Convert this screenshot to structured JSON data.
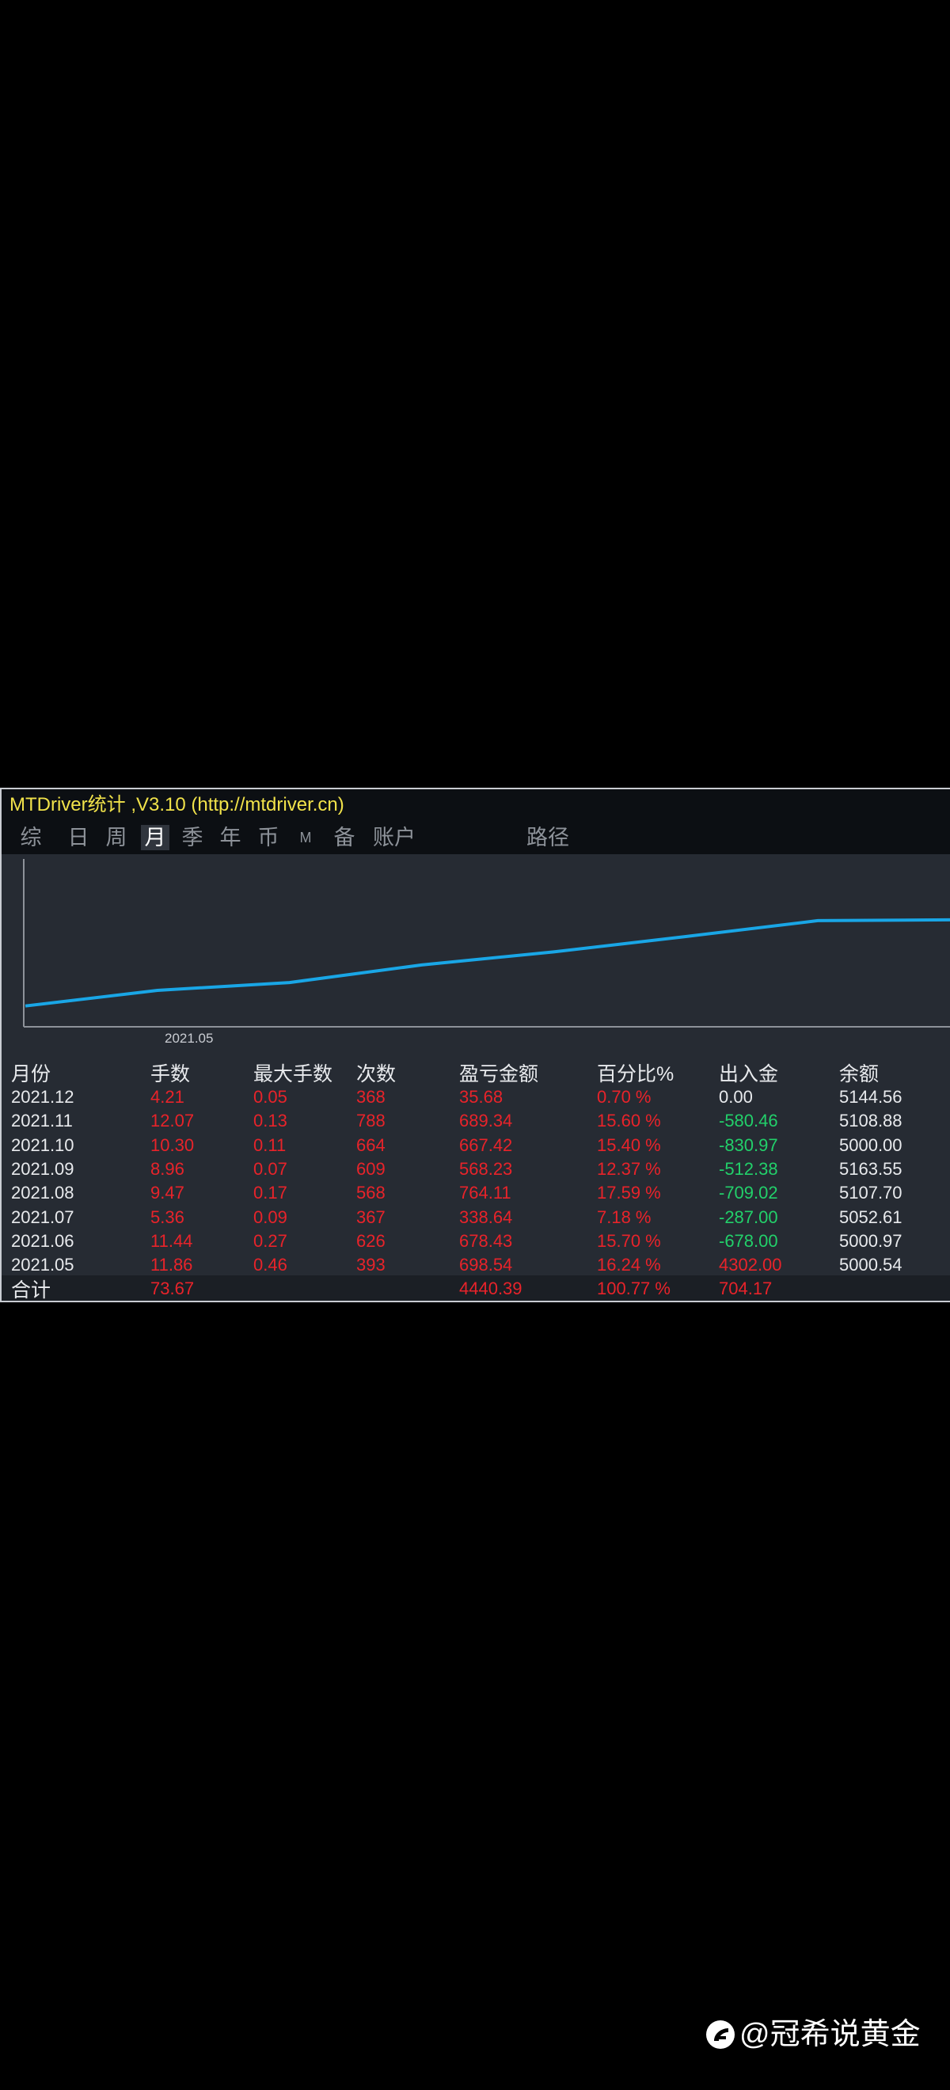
{
  "window": {
    "title": "MTDriver统计 ,V3.10 (http://mtdriver.cn)"
  },
  "tabs": [
    {
      "label": "综",
      "active": false
    },
    {
      "label": "日",
      "active": false
    },
    {
      "label": "周",
      "active": false
    },
    {
      "label": "月",
      "active": true
    },
    {
      "label": "季",
      "active": false
    },
    {
      "label": "年",
      "active": false
    },
    {
      "label": "币",
      "active": false
    },
    {
      "label": "M",
      "active": false
    },
    {
      "label": "备",
      "active": false
    },
    {
      "label": "账户",
      "active": false
    },
    {
      "label": "路径",
      "active": false
    }
  ],
  "chart_data": {
    "type": "line",
    "x_tick_label": "2021.05",
    "line_color": "#19a6e6",
    "grid": false,
    "x": [
      "2021.05",
      "2021.06",
      "2021.07",
      "2021.08",
      "2021.09",
      "2021.10",
      "2021.11",
      "2021.12"
    ],
    "y": [
      698.54,
      1376.97,
      1715.61,
      2479.72,
      3047.95,
      3715.37,
      4404.71,
      4440.39
    ]
  },
  "table": {
    "headers": [
      "月份",
      "手数",
      "最大手数",
      "次数",
      "盈亏金额",
      "百分比%",
      "出入金",
      "余额"
    ],
    "rows": [
      [
        "2021.12",
        "4.21",
        "0.05",
        "368",
        "35.68",
        "0.70 %",
        "0.00",
        "5144.56"
      ],
      [
        "2021.11",
        "12.07",
        "0.13",
        "788",
        "689.34",
        "15.60 %",
        "-580.46",
        "5108.88"
      ],
      [
        "2021.10",
        "10.30",
        "0.11",
        "664",
        "667.42",
        "15.40 %",
        "-830.97",
        "5000.00"
      ],
      [
        "2021.09",
        "8.96",
        "0.07",
        "609",
        "568.23",
        "12.37 %",
        "-512.38",
        "5163.55"
      ],
      [
        "2021.08",
        "9.47",
        "0.17",
        "568",
        "764.11",
        "17.59 %",
        "-709.02",
        "5107.70"
      ],
      [
        "2021.07",
        "5.36",
        "0.09",
        "367",
        "338.64",
        "7.18 %",
        "-287.00",
        "5052.61"
      ],
      [
        "2021.06",
        "11.44",
        "0.27",
        "626",
        "678.43",
        "15.70 %",
        "-678.00",
        "5000.97"
      ],
      [
        "2021.05",
        "11.86",
        "0.46",
        "393",
        "698.54",
        "16.24 %",
        "4302.00",
        "5000.54"
      ]
    ],
    "cash_colors": [
      "white",
      "green",
      "green",
      "green",
      "green",
      "green",
      "green",
      "red"
    ],
    "total": {
      "label": "合计",
      "lots": "73.67",
      "profit": "4440.39",
      "percent": "100.77 %",
      "cash": "704.17"
    }
  },
  "colors": {
    "positive": "#e8232a",
    "negative": "#22d06a",
    "title": "#f1e24a",
    "background": "#262b33"
  },
  "watermark": {
    "text": "@冠希说黄金",
    "icon": "weibo-style-logo-icon"
  }
}
